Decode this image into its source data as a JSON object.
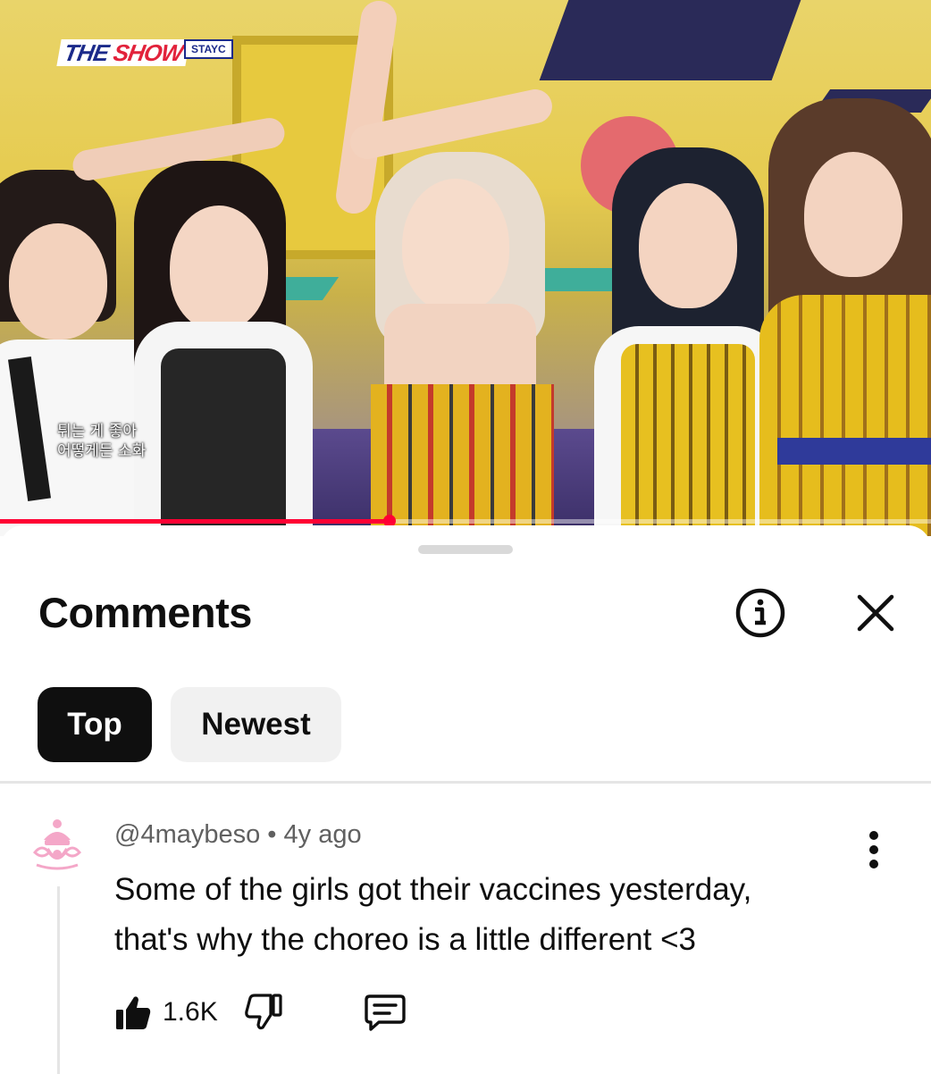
{
  "video": {
    "channel_logo_text_a": "THE ",
    "channel_logo_text_b": "SHOW",
    "logo_tag": "STAYC",
    "subtitle_line_1": "튀는 게 좋아",
    "subtitle_line_2": "어떻게든 소화",
    "progress_fraction": 0.418,
    "progress_color": "#ff0033"
  },
  "comments_panel": {
    "title": "Comments",
    "info_icon": "info-icon",
    "close_icon": "close-icon",
    "sort_chips": [
      {
        "label": "Top",
        "selected": true
      },
      {
        "label": "Newest",
        "selected": false
      }
    ]
  },
  "comment": {
    "author": "@4maybeso",
    "separator": " • ",
    "age": "4y ago",
    "text": "Some of the girls got their vaccines yesterday, that's why the choreo is a little different <3",
    "like_count": "1.6K",
    "avatar_color": "#f4a7c8"
  }
}
